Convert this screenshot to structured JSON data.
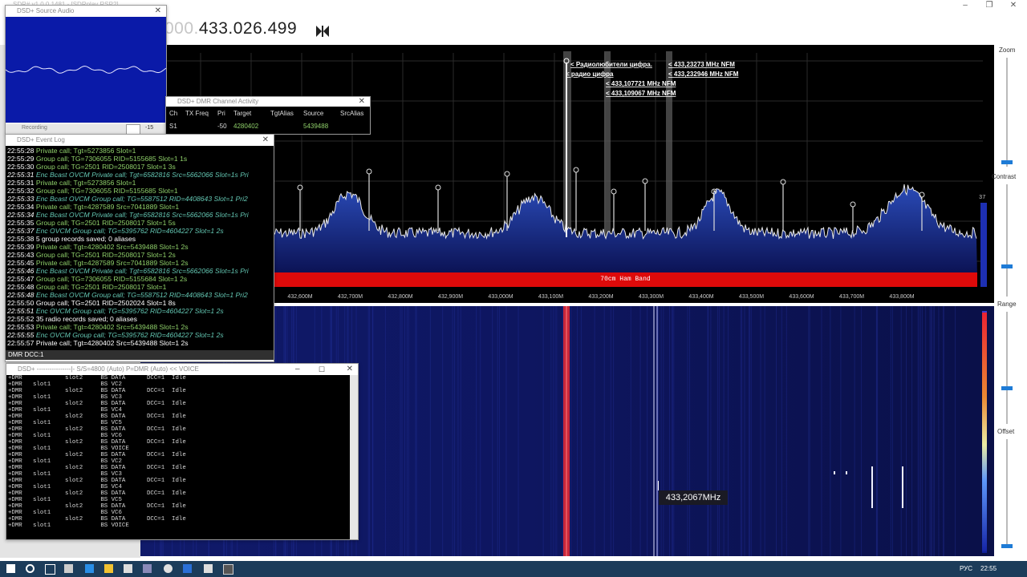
{
  "main": {
    "title": "SDR# v1.0.0.1481 - [SDRplay RSP2]",
    "frequency_prefix": "000.",
    "frequency_main": "433.026.499",
    "spectrum": {
      "band_label": "70cm Ham Band",
      "freq_ticks": [
        "432,600M",
        "432,700M",
        "432,800M",
        "432,900M",
        "433,000M",
        "433,100M",
        "433,200M",
        "433,300M",
        "433,400M",
        "433,500M",
        "433,600M",
        "433,700M",
        "433,800M"
      ],
      "annotations": [
        "< Радиолюбители цифра.",
        "< радио цифра",
        "< 433,107721 MHz NFM",
        "< 433,109067 MHz NFM",
        "< 433,23273 MHz NFM",
        "< 433,232946 MHz NFM"
      ],
      "level_value": "37"
    },
    "waterfall_cursor_label": "433,2067MHz",
    "right_panel": {
      "zoom_label": "Zoom",
      "contrast_label": "Contrast",
      "range_label": "Range",
      "offset_label": "Offset"
    }
  },
  "source_audio": {
    "title": "DSD+ Source Audio",
    "bottom_label": "-15",
    "bar_label": "Recording"
  },
  "channel_activity": {
    "title": "DSD+ DMR Channel Activity",
    "columns": [
      "Ch",
      "TX Freq",
      "Pri",
      "Target",
      "TgtAlias",
      "Source",
      "SrcAlias"
    ],
    "rows": [
      {
        "ch": "S1",
        "freq": "",
        "pri": "-50",
        "target": "4280402",
        "tgtalias": "",
        "source": "5439488",
        "srcalias": ""
      }
    ]
  },
  "event_log": {
    "title": "DSD+ Event Log",
    "status": "DMR  DCC:1",
    "lines": [
      {
        "time": "22:55:28",
        "text": "Private call; Tgt=5273856  Slot=1",
        "kind": "g"
      },
      {
        "time": "22:55:29",
        "text": "Group call; TG=7306055  RID=5155685  Slot=1  1s",
        "kind": "g"
      },
      {
        "time": "22:55:30",
        "text": "Group call; TG=2501  RID=2508017  Slot=1  3s",
        "kind": "g"
      },
      {
        "time": "22:55:31",
        "text": "Enc Bcast OVCM Private call; Tgt=6582816  Src=5662066  Slot=1s Pri",
        "kind": "e"
      },
      {
        "time": "22:55:31",
        "text": "Private call; Tgt=5273856  Slot=1",
        "kind": "g"
      },
      {
        "time": "22:55:32",
        "text": "Group call; TG=7306055  RID=5155685  Slot=1",
        "kind": "g"
      },
      {
        "time": "22:55:33",
        "text": "Enc Bcast OVCM Group call; TG=5587512  RID=4408643  Slot=1 Pri2",
        "kind": "e"
      },
      {
        "time": "22:55:34",
        "text": "Private call; Tgt=4287589  Src=7041889  Slot=1",
        "kind": "g"
      },
      {
        "time": "22:55:34",
        "text": "Enc Bcast OVCM Private call; Tgt=6582816  Src=5662066  Slot=1s Pri",
        "kind": "e"
      },
      {
        "time": "22:55:35",
        "text": "Group call; TG=2501  RID=2508017  Slot=1  5s",
        "kind": "g"
      },
      {
        "time": "22:55:37",
        "text": "Enc OVCM Group call; TG=5395762  RID=4604227  Slot=1  2s",
        "kind": "e"
      },
      {
        "time": "22:55:38",
        "text": "5 group records saved; 0 aliases",
        "kind": "w"
      },
      {
        "time": "22:55:39",
        "text": "Private call; Tgt=4280402  Src=5439488  Slot=1  2s",
        "kind": "g"
      },
      {
        "time": "22:55:43",
        "text": "Group call; TG=2501  RID=2508017  Slot=1  2s",
        "kind": "g"
      },
      {
        "time": "22:55:45",
        "text": "Private call; Tgt=4287589  Src=7041889  Slot=1  2s",
        "kind": "g"
      },
      {
        "time": "22:55:46",
        "text": "Enc Bcast OVCM Private call; Tgt=6582816  Src=5662066  Slot=1s Pri",
        "kind": "e"
      },
      {
        "time": "22:55:47",
        "text": "Group call; TG=7306055  RID=5155684  Slot=1  2s",
        "kind": "g"
      },
      {
        "time": "22:55:48",
        "text": "Group call; TG=2501  RID=2508017  Slot=1",
        "kind": "g"
      },
      {
        "time": "22:55:48",
        "text": "Enc Bcast OVCM Group call; TG=5587512  RID=4408643  Slot=1 Pri2",
        "kind": "e"
      },
      {
        "time": "22:55:50",
        "text": "Group call; TG=2501  RID=2502024  Slot=1  8s",
        "kind": "w"
      },
      {
        "time": "22:55:51",
        "text": "Enc OVCM Group call; TG=5395762  RID=4604227  Slot=1  2s",
        "kind": "e"
      },
      {
        "time": "22:55:52",
        "text": "35 radio records saved; 0 aliases",
        "kind": "w"
      },
      {
        "time": "22:55:53",
        "text": "Private call; Tgt=4280402  Src=5439488  Slot=1  2s",
        "kind": "g"
      },
      {
        "time": "22:55:55",
        "text": "Enc OVCM Group call; TG=5395762  RID=4604227  Slot=1  2s",
        "kind": "e"
      },
      {
        "time": "22:55:57",
        "text": "Private call; Tgt=4280402  Src=5439488  Slot=1  2s",
        "kind": "w"
      }
    ]
  },
  "console": {
    "title": "DSD+  ----------------|- S/S=4800 (Auto) P=DMR (Auto)   << VOICE",
    "lines": [
      "+DMR            slot2     BS DATA      DCC=1  Idle",
      "+DMR   slot1              BS VC2",
      "+DMR            slot2     BS DATA      DCC=1  Idle",
      "+DMR   slot1              BS VC3",
      "+DMR            slot2     BS DATA      DCC=1  Idle",
      "+DMR   slot1              BS VC4",
      "+DMR            slot2     BS DATA      DCC=1  Idle",
      "+DMR   slot1              BS VC5",
      "+DMR            slot2     BS DATA      DCC=1  Idle",
      "+DMR   slot1              BS VC6",
      "+DMR            slot2     BS DATA      DCC=1  Idle",
      "+DMR   slot1              BS VOICE",
      "+DMR            slot2     BS DATA      DCC=1  Idle",
      "+DMR   slot1              BS VC2",
      "+DMR            slot2     BS DATA      DCC=1  Idle",
      "+DMR   slot1              BS VC3",
      "+DMR            slot2     BS DATA      DCC=1  Idle",
      "+DMR   slot1              BS VC4",
      "+DMR            slot2     BS DATA      DCC=1  Idle",
      "+DMR   slot1              BS VC5",
      "+DMR            slot2     BS DATA      DCC=1  Idle",
      "+DMR   slot1              BS VC6",
      "+DMR            slot2     BS DATA      DCC=1  Idle",
      "+DMR   slot1              BS VOICE"
    ]
  },
  "taskbar": {
    "lang": "РУС",
    "time": "22:55"
  },
  "colors": {
    "green": "#8fd06a",
    "enc": "#63c6b2",
    "white": "#ffffff",
    "band": "#dd0a0a",
    "accent": "#1e7bd6"
  }
}
